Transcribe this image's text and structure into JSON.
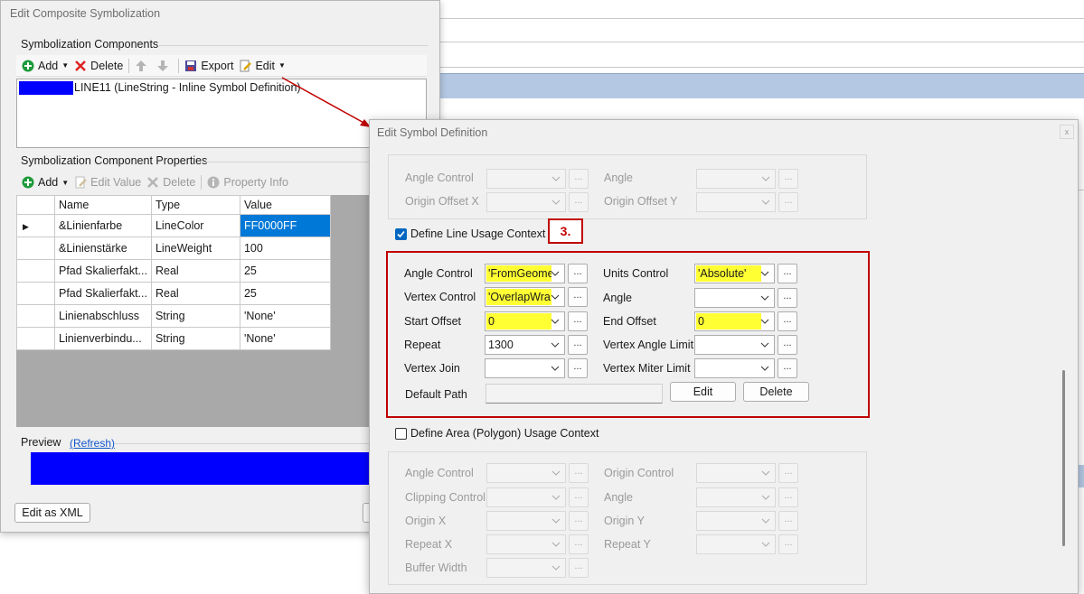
{
  "composite": {
    "title": "Edit Composite Symbolization",
    "components_group": "Symbolization Components",
    "toolbar": {
      "add": "Add",
      "delete": "Delete",
      "export": "Export",
      "edit": "Edit"
    },
    "list_item": "LINE11 (LineString - Inline Symbol Definition)",
    "props_group": "Symbolization Component Properties",
    "props_toolbar": {
      "add": "Add",
      "edit_value": "Edit Value",
      "delete": "Delete",
      "property_info": "Property Info"
    },
    "table": {
      "headers": [
        "Name",
        "Type",
        "Value"
      ],
      "rows": [
        [
          "&Linienfarbe",
          "LineColor",
          "FF0000FF"
        ],
        [
          "&Linienstärke",
          "LineWeight",
          "100"
        ],
        [
          "Pfad Skalierfakt...",
          "Real",
          "25"
        ],
        [
          "Pfad Skalierfakt...",
          "Real",
          "25"
        ],
        [
          "Linienabschluss",
          "String",
          "'None'"
        ],
        [
          "Linienverbindu...",
          "String",
          "'None'"
        ]
      ]
    },
    "preview_label": "Preview",
    "refresh_link": "(Refresh)",
    "preview_color": "#0000ff",
    "edit_xml": "Edit as XML"
  },
  "symbol_def": {
    "title": "Edit Symbol Definition",
    "close": "x",
    "top_section": {
      "angle_control": "Angle Control",
      "angle": "Angle",
      "origin_offset_x": "Origin Offset X",
      "origin_offset_y": "Origin Offset Y"
    },
    "line_usage": {
      "checkbox_label": "Define Line Usage Context",
      "callout": "3.",
      "angle_control": {
        "label": "Angle Control",
        "value": "'FromGeome"
      },
      "units_control": {
        "label": "Units Control",
        "value": "'Absolute'"
      },
      "vertex_control": {
        "label": "Vertex Control",
        "value": "'OverlapWra"
      },
      "angle": {
        "label": "Angle",
        "value": ""
      },
      "start_offset": {
        "label": "Start Offset",
        "value": "0"
      },
      "end_offset": {
        "label": "End Offset",
        "value": "0"
      },
      "repeat": {
        "label": "Repeat",
        "value": "1300"
      },
      "vertex_angle_limit": {
        "label": "Vertex Angle Limit",
        "value": ""
      },
      "vertex_join": {
        "label": "Vertex Join",
        "value": ""
      },
      "vertex_miter_limit": {
        "label": "Vertex Miter Limit",
        "value": ""
      },
      "default_path": {
        "label": "Default Path",
        "value": ""
      },
      "edit_button": "Edit",
      "delete_button": "Delete"
    },
    "area_usage": {
      "checkbox_label": "Define Area (Polygon) Usage Context",
      "angle_control": "Angle Control",
      "origin_control": "Origin Control",
      "clipping_control": "Clipping Control",
      "angle": "Angle",
      "origin_x": "Origin X",
      "origin_y": "Origin Y",
      "repeat_x": "Repeat X",
      "repeat_y": "Repeat Y",
      "buffer_width": "Buffer Width"
    },
    "ellipsis": "..."
  },
  "colors": {
    "highlight": "#ffff33",
    "annotation": "#c00000",
    "selection": "#0078d7"
  }
}
